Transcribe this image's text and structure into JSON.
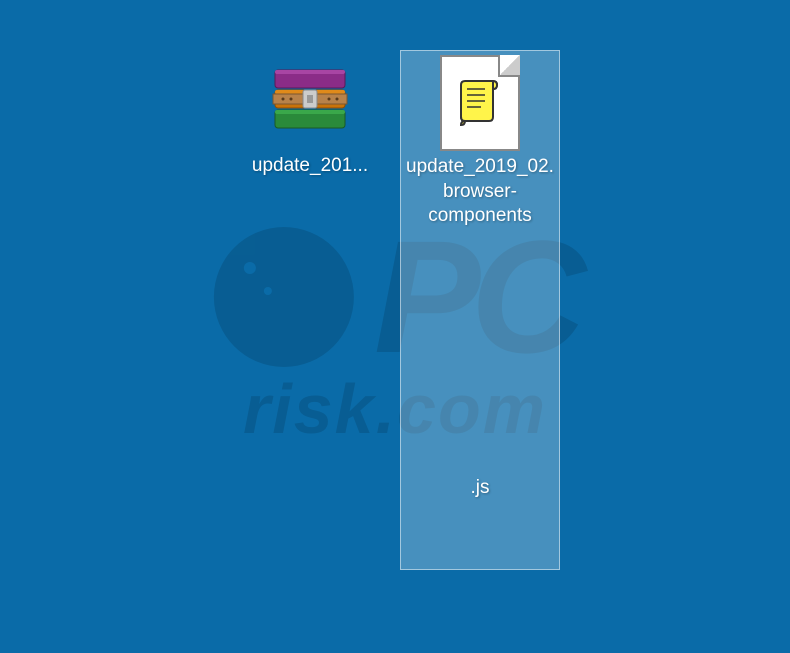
{
  "desktop": {
    "icons": [
      {
        "type": "rar-archive",
        "label": "update_201...",
        "selected": false
      },
      {
        "type": "js-file",
        "label": "update_2019_02.browser-components\n\n\n\n\n\n\n\n\n\n\n.js",
        "selected": true
      }
    ]
  },
  "watermark": {
    "brand": "PC",
    "site": "risk.com"
  }
}
